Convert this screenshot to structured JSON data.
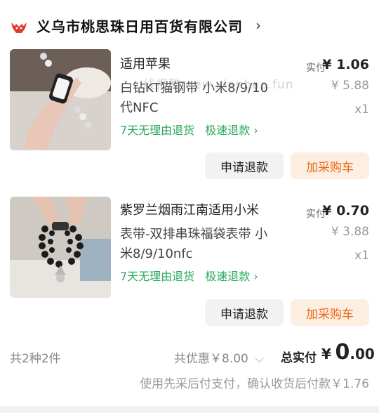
{
  "shop": {
    "name": "义乌市桃思珠日用百货有限公司",
    "chevron": "›"
  },
  "items": [
    {
      "title_line1": "适用苹果",
      "title_line2": "白钻KT猫钢带 小米8/9/10",
      "title_line3": "代NFC",
      "paid_label": "实付",
      "paid_value": "¥ 1.06",
      "original_price": "¥ 5.88",
      "quantity": "x1",
      "tag_return": "7天无理由退货",
      "tag_fast": "极速退款 ›",
      "refund_button": "申请退款",
      "cart_button": "加采购车"
    },
    {
      "title_line1": "紫罗兰烟雨江南适用小米",
      "title_line2": "表带-双排串珠福袋表带 小",
      "title_line3": "米8/9/10nfc",
      "paid_label": "实付",
      "paid_value": "¥ 0.70",
      "original_price": "¥ 3.88",
      "quantity": "x1",
      "tag_return": "7天无理由退货",
      "tag_fast": "极速退款 ›",
      "refund_button": "申请退款",
      "cart_button": "加采购车"
    }
  ],
  "watermark": "线报酷 new.xianbao.fun",
  "summary": {
    "count": "共2种2件",
    "discount": "共优惠￥8.00",
    "discount_chevron": "⌵",
    "total_label": "总实付",
    "total_currency": "¥",
    "total_integer": "0",
    "total_decimal": ".00",
    "note": "使用先采后付支付，确认收货后付款￥1.76"
  },
  "colors": {
    "accent_orange": "#e86a1a",
    "tag_green": "#2aa85a",
    "shop_icon_red": "#e23b2e"
  }
}
